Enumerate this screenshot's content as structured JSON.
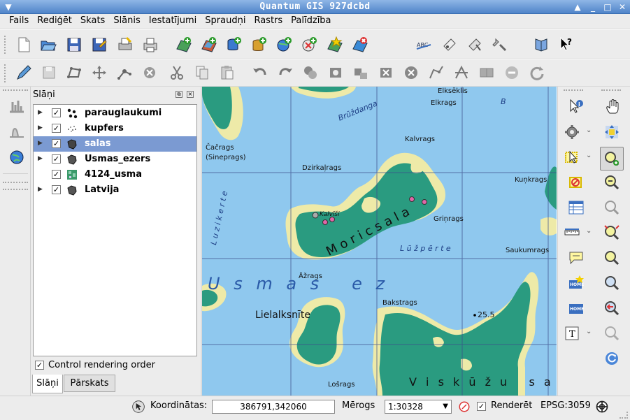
{
  "window": {
    "title": "Quantum GIS 927dcbd"
  },
  "menu": [
    "Fails",
    "Rediģēt",
    "Skats",
    "Slānis",
    "Iestatījumi",
    "Spraudņi",
    "Rastrs",
    "Palīdzība"
  ],
  "layers_panel": {
    "title": "Slāņi",
    "layers": [
      {
        "name": "parauglaukumi",
        "checked": true,
        "expand": true,
        "icon": "point-layer-icon"
      },
      {
        "name": "kupfers",
        "checked": true,
        "expand": true,
        "icon": "raster-scatter-icon"
      },
      {
        "name": "salas",
        "checked": true,
        "expand": true,
        "icon": "polygon-layer-icon",
        "selected": true
      },
      {
        "name": "Usmas_ezers",
        "checked": true,
        "expand": true,
        "icon": "polygon-layer-icon"
      },
      {
        "name": "4124_usma",
        "checked": true,
        "expand": false,
        "icon": "raster-layer-icon"
      },
      {
        "name": "Latvija",
        "checked": true,
        "expand": true,
        "icon": "polygon-layer-icon"
      }
    ],
    "control_rendering_order": "Control rendering order",
    "tabs": [
      "Slāņi",
      "Pārskats"
    ]
  },
  "map": {
    "labels": {
      "bruzdanga": "Brūždanga",
      "elkseklis": "Elksēklis",
      "elkrags": "Elkrags",
      "b": "B",
      "cacrags": "Čačrags",
      "sineprags": "(Sineprags)",
      "kalvrags": "Kalvrags",
      "dzirkalrags": "Dzirkaļrags",
      "kunkrags": "Kuņkrags",
      "luzkerte": "L u z i k e r t e",
      "moricsala": "M o r i c s a l a",
      "kalvisi": "Kalvīši",
      "grinrags": "Griņrags",
      "luzperte": "L ū ž p ē r t e",
      "saukumrags": "Saukumrags",
      "azrags": "Āžrags",
      "usmas": "U s m a s   e z",
      "lielalksnite": "Lielalksnīte",
      "bakstrags": "Bakstrags",
      "spot_height": "25.5",
      "losrags": "Lošrags",
      "viskuzu": "V i s k ū ž u   s a l a"
    }
  },
  "status": {
    "coords_label": "Koordinātas:",
    "coords_value": "386791,342060",
    "scale_label": "Mērogs",
    "scale_value": "1:30328",
    "render_label": "Renderēt",
    "render_checked": true,
    "crs": "EPSG:3059"
  },
  "colors": {
    "water": "#8fc8ee",
    "land": "#2a9b80",
    "shore": "#eeeaa8",
    "grid": "#3a4a8a",
    "selected_row": "#7b9ad2",
    "point": "#e066a8"
  }
}
